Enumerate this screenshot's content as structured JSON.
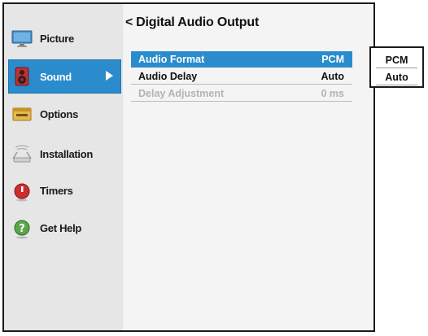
{
  "header": {
    "title": "Digital Audio Output",
    "back_glyph": "<"
  },
  "sidebar": {
    "items": [
      {
        "label": "Picture",
        "icon": "monitor-icon"
      },
      {
        "label": "Sound",
        "icon": "speaker-icon",
        "selected": true
      },
      {
        "label": "Options",
        "icon": "options-icon"
      },
      {
        "label": "Installation",
        "icon": "antenna-icon"
      },
      {
        "label": "Timers",
        "icon": "timer-icon"
      },
      {
        "label": "Get Help",
        "icon": "help-icon"
      }
    ]
  },
  "settings": [
    {
      "label": "Audio Format",
      "value": "PCM",
      "selected": true
    },
    {
      "label": "Audio Delay",
      "value": "Auto"
    },
    {
      "label": "Delay Adjustment",
      "value": "0 ms",
      "disabled": true
    }
  ],
  "popup": {
    "options": [
      "PCM",
      "Auto"
    ]
  },
  "colors": {
    "accent": "#2a8ccc",
    "disabled_text": "#b3b3b3"
  }
}
